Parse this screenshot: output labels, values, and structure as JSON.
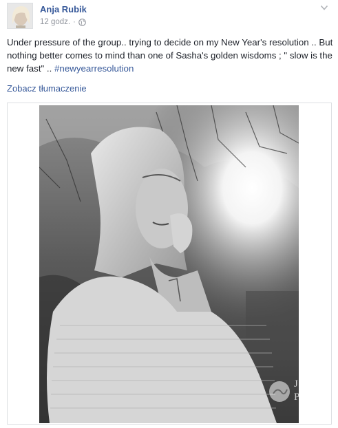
{
  "post": {
    "author": "Anja Rubik",
    "time": "12 godz.",
    "separator": "·",
    "privacy_icon": "globe-icon",
    "menu_icon": "chevron-down-icon",
    "text_main": "Under pressure of the group.. trying to decide on my New Year's resolution .. But nothing better comes to mind than one of Sasha's golden wisdoms ; \" slow is the new fast\" .. ",
    "hashtag": "#newyearresolution",
    "translate_label": "Zobacz tłumaczenie"
  },
  "photo": {
    "watermark_line1": "JASTR",
    "watermark_line2": "POST"
  },
  "colors": {
    "link": "#365899",
    "meta": "#90949c",
    "text": "#1d2129",
    "border": "#dddfe2"
  }
}
